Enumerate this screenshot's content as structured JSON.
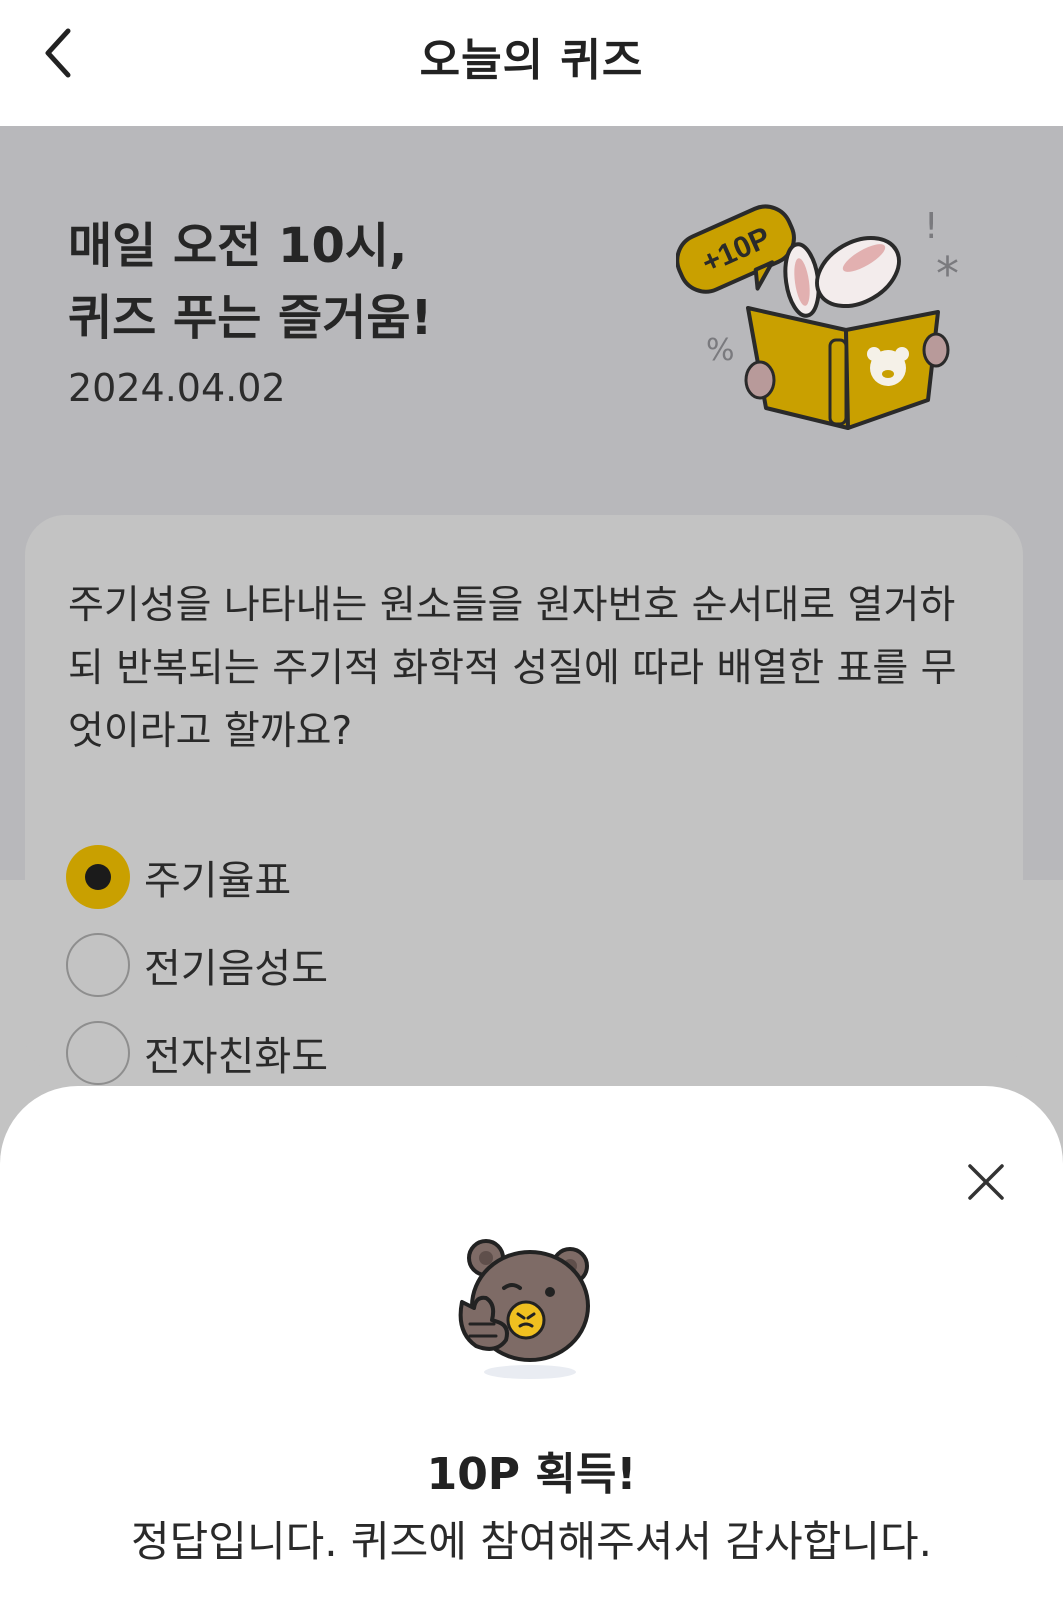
{
  "header": {
    "title": "오늘의 퀴즈",
    "back_icon": "chevron-left-icon"
  },
  "hero": {
    "line1": "매일 오전 10시,",
    "line2": "퀴즈 푸는 즐거움!",
    "date": "2024.04.02",
    "badge_text": "+10P"
  },
  "quiz": {
    "question": "주기성을 나타내는 원소들을 원자번호 순서대로 열거하되 반복되는 주기적 화학적 성질에 따라 배열한 표를 무엇이라고 할까요?",
    "options": [
      {
        "label": "주기율표",
        "selected": true
      },
      {
        "label": "전기음성도",
        "selected": false
      },
      {
        "label": "전자친화도",
        "selected": false
      }
    ]
  },
  "result_sheet": {
    "title": "10P 획득!",
    "message": "정답입니다. 퀴즈에 참여해주셔서 감사합니다.",
    "close_icon": "close-icon"
  },
  "colors": {
    "accent": "#c9a000",
    "dim_overlay": "#b8b8bb",
    "bear_brown": "#7e6b66",
    "sheet_bg": "#ffffff"
  }
}
